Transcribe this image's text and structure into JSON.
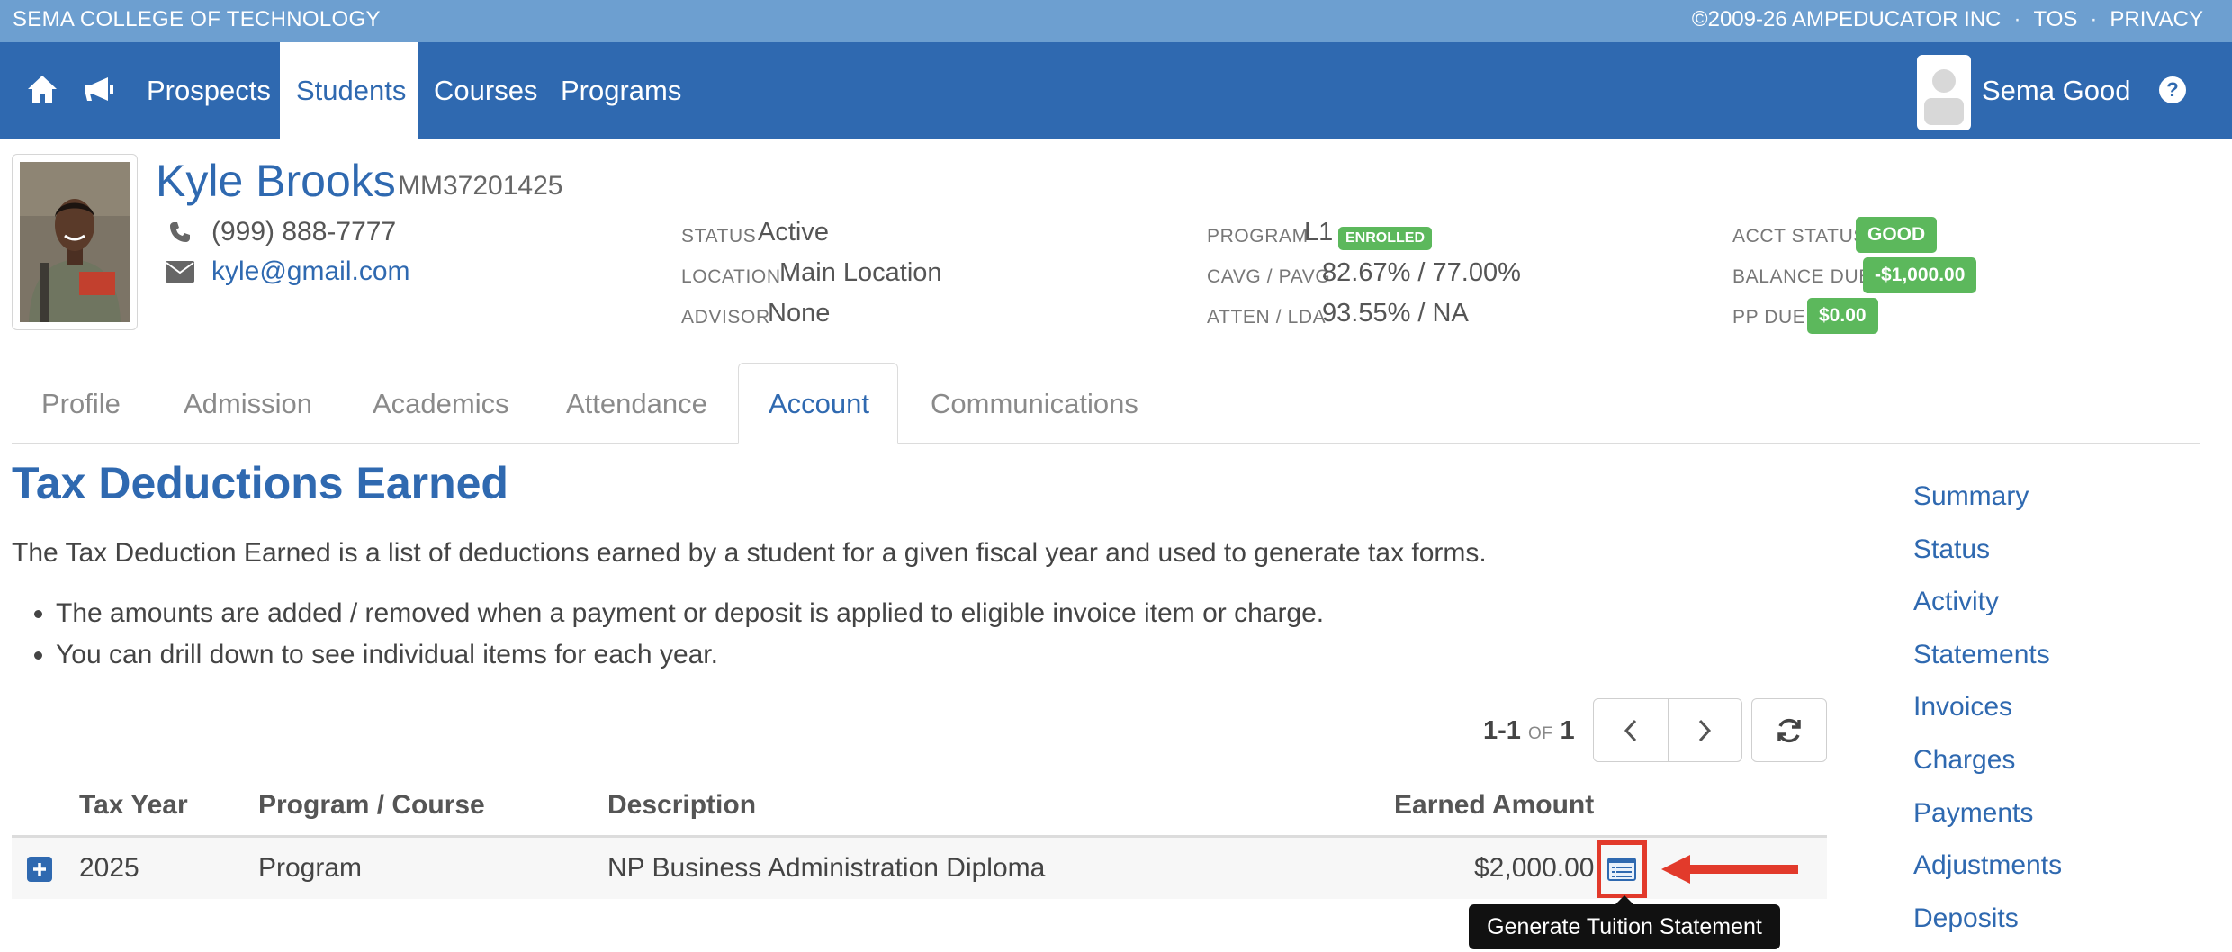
{
  "topbar": {
    "college": "SEMA COLLEGE OF TECHNOLOGY",
    "copyright": "©2009-26 AMPEDUCATOR INC",
    "tos": "TOS",
    "privacy": "PRIVACY"
  },
  "nav": {
    "items": [
      "Prospects",
      "Students",
      "Courses",
      "Programs"
    ],
    "active": "Students",
    "user_name": "Sema Good",
    "icons": [
      "home-icon",
      "megaphone-icon",
      "avatar",
      "help-icon"
    ]
  },
  "student": {
    "name": "Kyle Brooks",
    "id": "MM37201425",
    "phone": "(999) 888-7777",
    "email": "kyle@gmail.com",
    "status_label": "STATUS",
    "status": "Active",
    "location_label": "LOCATION",
    "location": "Main Location",
    "advisor_label": "ADVISOR",
    "advisor": "None",
    "program_label": "PROGRAM",
    "program": "L1",
    "program_badge": "ENROLLED",
    "cavg_label": "CAVG / PAVG",
    "cavg": "82.67% / 77.00%",
    "atten_label": "ATTEN / LDA",
    "atten": "93.55% / NA",
    "acct_label": "ACCT STATUS",
    "acct": "GOOD",
    "balance_label": "BALANCE DUE",
    "balance": "-$1,000.00",
    "ppdue_label": "PP DUE",
    "ppdue": "$0.00",
    "badge_color": "#5cb85c"
  },
  "tabs": [
    "Profile",
    "Admission",
    "Academics",
    "Attendance",
    "Account",
    "Communications"
  ],
  "active_tab": "Account",
  "page": {
    "title": "Tax Deductions Earned",
    "intro": "The Tax Deduction Earned is a list of deductions earned by a student for a given fiscal year and used to generate tax forms.",
    "bullets": [
      "The amounts are added / removed when a payment or deposit is applied to eligible invoice item or charge.",
      "You can drill down to see individual items for each year."
    ]
  },
  "pager": {
    "range": "1-1",
    "of": "OF",
    "total": "1"
  },
  "table": {
    "headers": [
      "Tax Year",
      "Program / Course",
      "Description",
      "Earned Amount"
    ],
    "rows": [
      {
        "year": "2025",
        "type": "Program",
        "description": "NP Business Administration Diploma",
        "amount": "$2,000.00"
      }
    ]
  },
  "tooltip": "Generate Tuition Statement",
  "sidenav": [
    "Summary",
    "Status",
    "Activity",
    "Statements",
    "Invoices",
    "Charges",
    "Payments",
    "Adjustments",
    "Deposits"
  ],
  "colors": {
    "primary": "#2f69b0",
    "topstrip": "#6d9fd0",
    "highlight": "#e23a2b"
  }
}
